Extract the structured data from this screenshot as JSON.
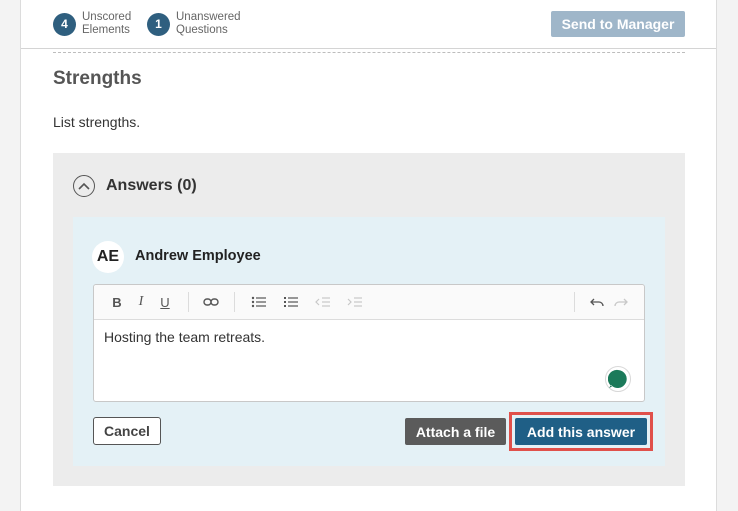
{
  "header": {
    "stats": [
      {
        "count": "4",
        "label_line1": "Unscored",
        "label_line2": "Elements"
      },
      {
        "count": "1",
        "label_line1": "Unanswered",
        "label_line2": "Questions"
      }
    ],
    "send_button_label": "Send to Manager"
  },
  "section": {
    "title": "Strengths",
    "description": "List strengths."
  },
  "answers": {
    "header_label": "Answers (0)",
    "author_initials": "AE",
    "author_name": "Andrew Employee",
    "editor_text": "Hosting the team retreats.",
    "toolbar_icons": [
      "bold-icon",
      "italic-icon",
      "underline-icon",
      "link-icon",
      "bulleted-list-icon",
      "numbered-list-icon",
      "outdent-icon",
      "indent-icon",
      "undo-icon",
      "redo-icon"
    ],
    "cancel_label": "Cancel",
    "attach_label": "Attach a file",
    "add_label": "Add this answer"
  },
  "colors": {
    "accent": "#1f5f86",
    "badge": "#2f5f7f",
    "highlight": "#e0504a",
    "send_disabled": "#9fb6c9"
  }
}
